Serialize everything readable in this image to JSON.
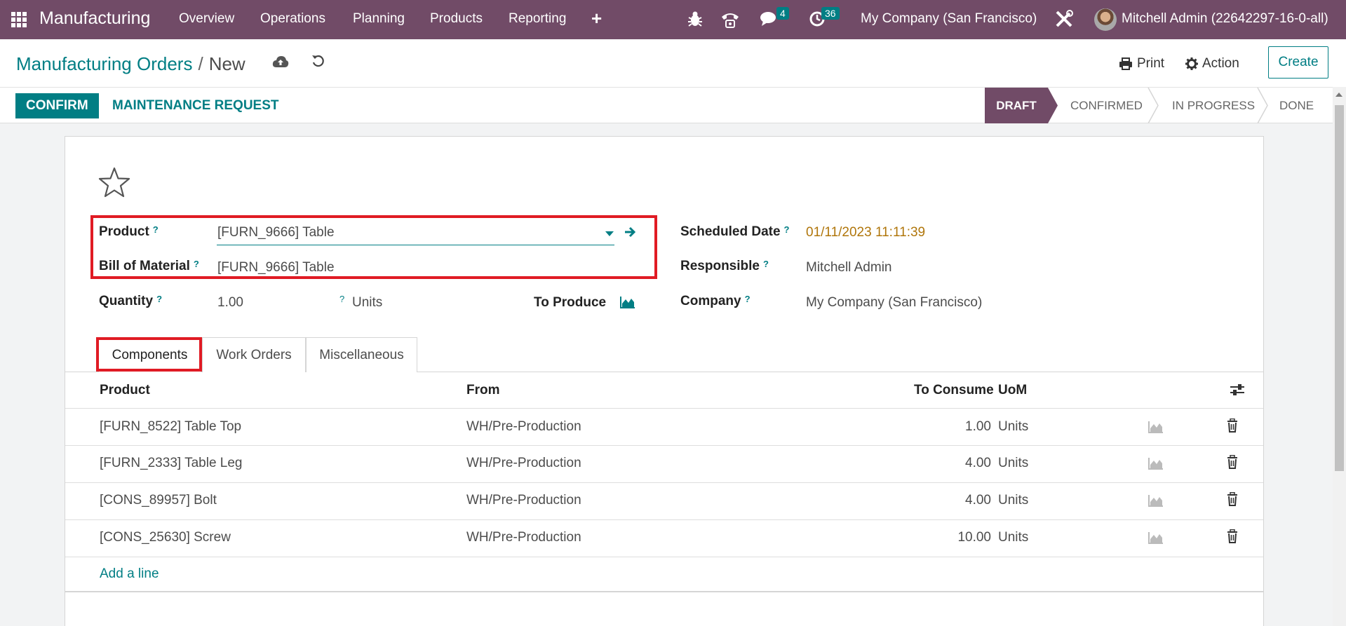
{
  "navbar": {
    "app_name": "Manufacturing",
    "menu": [
      "Overview",
      "Operations",
      "Planning",
      "Products",
      "Reporting"
    ],
    "messages_count": "4",
    "activities_count": "36",
    "company": "My Company (San Francisco)",
    "user": "Mitchell Admin (22642297-16-0-all)"
  },
  "breadcrumb": {
    "parent": "Manufacturing Orders",
    "current": "New"
  },
  "control": {
    "print_label": "Print",
    "action_label": "Action",
    "create_label": "Create"
  },
  "statusbar": {
    "confirm_label": "CONFIRM",
    "maintenance_label": "MAINTENANCE REQUEST",
    "stages": [
      "DRAFT",
      "CONFIRMED",
      "IN PROGRESS",
      "DONE"
    ],
    "active_stage": "DRAFT"
  },
  "form": {
    "product_label": "Product",
    "product_value": "[FURN_9666] Table",
    "bom_label": "Bill of Material",
    "bom_value": "[FURN_9666] Table",
    "quantity_label": "Quantity",
    "quantity_value": "1.00",
    "quantity_uom": "Units",
    "to_produce_label": "To Produce",
    "scheduled_label": "Scheduled Date",
    "scheduled_value": "01/11/2023 11:11:39",
    "responsible_label": "Responsible",
    "responsible_value": "Mitchell Admin",
    "company_label": "Company",
    "company_value": "My Company (San Francisco)",
    "help_mark": "?"
  },
  "tabs": [
    "Components",
    "Work Orders",
    "Miscellaneous"
  ],
  "components": {
    "headers": {
      "product": "Product",
      "from": "From",
      "to_consume": "To Consume",
      "uom": "UoM"
    },
    "rows": [
      {
        "product": "[FURN_8522] Table Top",
        "from": "WH/Pre-Production",
        "qty": "1.00",
        "uom": "Units"
      },
      {
        "product": "[FURN_2333] Table Leg",
        "from": "WH/Pre-Production",
        "qty": "4.00",
        "uom": "Units"
      },
      {
        "product": "[CONS_89957] Bolt",
        "from": "WH/Pre-Production",
        "qty": "4.00",
        "uom": "Units"
      },
      {
        "product": "[CONS_25630] Screw",
        "from": "WH/Pre-Production",
        "qty": "10.00",
        "uom": "Units"
      }
    ],
    "add_line_label": "Add a line"
  },
  "colors": {
    "brand": "#714b67",
    "accent": "#017e84",
    "highlight": "#e01b24",
    "date": "#b0760b"
  }
}
